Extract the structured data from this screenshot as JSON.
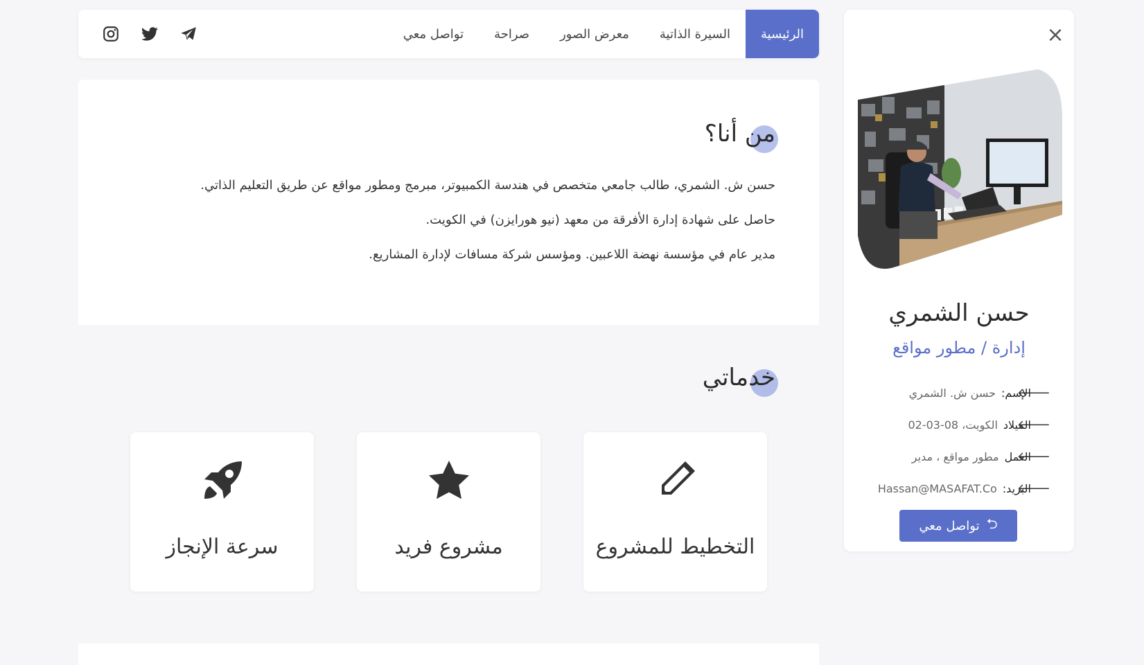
{
  "profile": {
    "close_icon": "×",
    "name": "حسن الشمري",
    "role": "إدارة / مطور مواقع",
    "info": [
      {
        "key": "الإسم:",
        "value": "حسن ش. الشمري"
      },
      {
        "key": "الميلاد",
        "value": "الكويت، 08-03-02"
      },
      {
        "key": "العمل",
        "value": "مطور مواقع ، مدير"
      },
      {
        "key": "البريد:",
        "value": "Hassan@MASAFAT.Co"
      }
    ],
    "arrow_icon": "arrow-left-icon",
    "contact_label": "تواصل معي",
    "contact_icon": "reply-icon"
  },
  "nav": {
    "items": [
      {
        "label": "الرئيسية",
        "active": true
      },
      {
        "label": "السيرة الذاتية",
        "active": false
      },
      {
        "label": "معرض الصور",
        "active": false
      },
      {
        "label": "صراحة",
        "active": false
      },
      {
        "label": "تواصل معي",
        "active": false
      }
    ],
    "social": [
      "telegram-icon",
      "twitter-icon",
      "instagram-icon"
    ]
  },
  "about": {
    "title": "من أنا؟",
    "lines": [
      "حسن ش. الشمري، طالب جامعي متخصص في هندسة الكمبيوتر، مبرمج ومطور مواقع عن طريق التعليم الذاتي.",
      "حاصل على شهادة إدارة الأفرقة من معهد (نيو هورايزن) في الكويت.",
      "مدير عام في مؤسسة نهضة اللاعبين. ومؤسس شركة مسافات لإدارة المشاريع."
    ]
  },
  "services": {
    "title": "خدماتي",
    "cards": [
      {
        "title": "التخطيط للمشروع",
        "icon": "pencil-icon"
      },
      {
        "title": "مشروع فريد",
        "icon": "star-icon"
      },
      {
        "title": "سرعة الإنجاز",
        "icon": "rocket-icon"
      }
    ]
  },
  "colors": {
    "accent": "#5a6fc9",
    "background": "#f6f6f8",
    "card": "#ffffff"
  }
}
